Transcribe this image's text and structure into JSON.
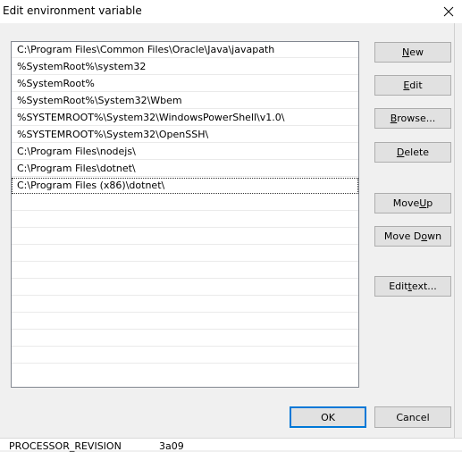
{
  "window": {
    "title": "Edit environment variable"
  },
  "list": {
    "items": [
      "C:\\Program Files\\Common Files\\Oracle\\Java\\javapath",
      "%SystemRoot%\\system32",
      "%SystemRoot%",
      "%SystemRoot%\\System32\\Wbem",
      "%SYSTEMROOT%\\System32\\WindowsPowerShell\\v1.0\\",
      "%SYSTEMROOT%\\System32\\OpenSSH\\",
      "C:\\Program Files\\nodejs\\",
      "C:\\Program Files\\dotnet\\",
      "C:\\Program Files (x86)\\dotnet\\"
    ],
    "selected_index": 8
  },
  "buttons": {
    "new": {
      "pre": "",
      "u": "N",
      "post": "ew"
    },
    "edit": {
      "pre": "",
      "u": "E",
      "post": "dit"
    },
    "browse": {
      "pre": "",
      "u": "B",
      "post": "rowse..."
    },
    "delete": {
      "pre": "",
      "u": "D",
      "post": "elete"
    },
    "move_up": {
      "pre": "Move ",
      "u": "U",
      "post": "p"
    },
    "move_down": {
      "pre": "Move D",
      "u": "o",
      "post": "wn"
    },
    "edit_text": {
      "pre": "Edit ",
      "u": "t",
      "post": "ext..."
    },
    "ok": "OK",
    "cancel": "Cancel"
  },
  "background": {
    "label": "PROCESSOR_REVISION",
    "value": "3a09"
  },
  "icons": {
    "close": "close-icon"
  },
  "colors": {
    "accent": "#0078d7"
  }
}
